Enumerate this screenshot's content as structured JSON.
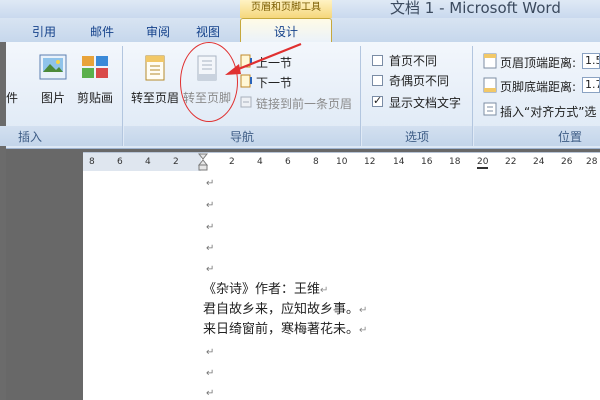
{
  "window": {
    "context_title": "页眉和页脚工具",
    "app_title": "文档 1 - Microsoft Word"
  },
  "tabs": [
    "引用",
    "邮件",
    "审阅",
    "视图"
  ],
  "active_tab": "设计",
  "ribbon": {
    "insert_group": {
      "label": "插入",
      "items": [
        "件",
        "图片",
        "剪贴画"
      ]
    },
    "nav_group": {
      "label": "导航",
      "goto_header": "转至页眉",
      "goto_footer": "转至页脚",
      "prev_section": "上一节",
      "next_section": "下一节",
      "link_previous": "链接到前一条页眉"
    },
    "options_group": {
      "label": "选项",
      "different_first": "首页不同",
      "different_odd_even": "奇偶页不同",
      "show_doc_text": "显示文档文字",
      "show_doc_text_checked": true
    },
    "position_group": {
      "label": "位置",
      "header_from_top": "页眉顶端距离:",
      "header_from_top_value": "1.5",
      "footer_from_bottom": "页脚底端距离:",
      "footer_from_bottom_value": "1.7",
      "insert_align_tab": "插入“对齐方式”选"
    }
  },
  "ruler": {
    "left_ticks": [
      "8",
      "6",
      "4",
      "2"
    ],
    "right_ticks": [
      "2",
      "4",
      "6",
      "8",
      "10",
      "12",
      "14",
      "16",
      "18",
      "20",
      "22",
      "24",
      "26",
      "28"
    ]
  },
  "document": {
    "lines": [
      "《杂诗》作者：王维",
      "君自故乡来，应知故乡事。",
      "来日绮窗前，寒梅著花未。"
    ],
    "paragraph_mark": "↵"
  },
  "annotation_color": "#e03030"
}
